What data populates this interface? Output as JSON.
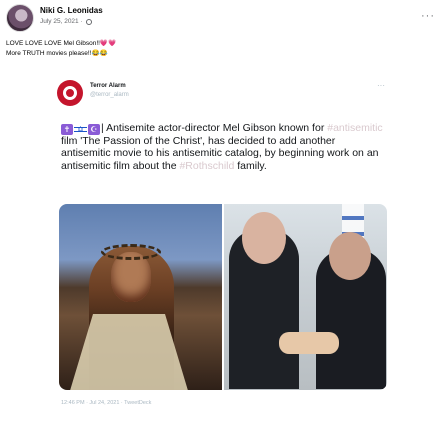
{
  "post": {
    "author": "Niki G. Leonidas",
    "date": "July 25, 2021 · ",
    "more_icon": "···",
    "caption_lines": [
      "LOVE LOVE LOVE Mel Gibson!!💗💗",
      "More TRUTH movies please!!😂😂"
    ]
  },
  "tweet": {
    "name": "Terror Alarm",
    "handle": "@terror_alarm",
    "more_icon": "···",
    "emoji_1": "✝",
    "emoji_2": "✡",
    "emoji_3": "☪",
    "text_1": "| Antisemite actor-director Mel Gibson known for ",
    "hashtag_1": "#antisemitic",
    "text_2": " film 'The Passion of the Christ', has decided to add another antisemitic movie to his antisemitic catalog, by beginning work on an antisemitic film about the ",
    "hashtag_2": "#Rothschild",
    "text_3": " family.",
    "footer": "12:46 PM · Jul 24, 2021 · TweetDeck"
  }
}
